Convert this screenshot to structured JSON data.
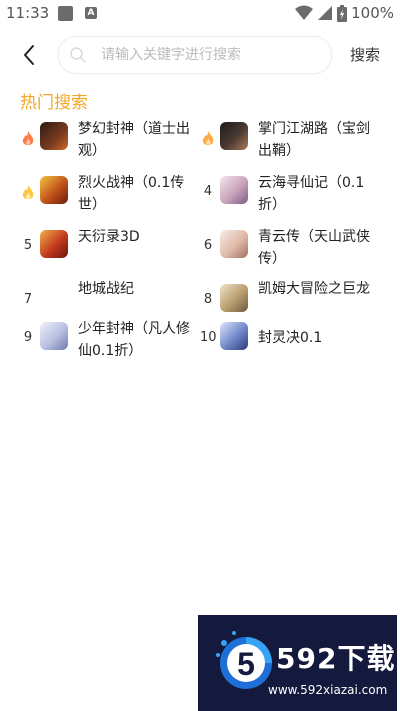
{
  "status_bar": {
    "time": "11:33",
    "battery": "100%",
    "notif_icon_b": "A"
  },
  "search": {
    "placeholder": "请输入关键字进行搜索",
    "value": "",
    "button_label": "搜索"
  },
  "section_title": "热门搜索",
  "hot_items": [
    {
      "rank": "",
      "hot": true,
      "name": "梦幻封神（道士出观）",
      "avatar_color": "#5a2b1a"
    },
    {
      "rank": "",
      "hot": true,
      "name": "掌门江湖路（宝剑出鞘）",
      "avatar_color": "#3b2f28"
    },
    {
      "rank": "",
      "hot": true,
      "name": "烈火战神（0.1传世）",
      "avatar_color": "#b8561b"
    },
    {
      "rank": "4",
      "hot": false,
      "name": "云海寻仙记（0.1折）",
      "avatar_color": "#d9b8c8"
    },
    {
      "rank": "5",
      "hot": false,
      "name": "天衍录3D",
      "avatar_color": "#c33a1e"
    },
    {
      "rank": "6",
      "hot": false,
      "name": "青云传（天山武侠传）",
      "avatar_color": "#e6c9c0"
    },
    {
      "rank": "7",
      "hot": false,
      "name": "地城战纪",
      "avatar_color": ""
    },
    {
      "rank": "8",
      "hot": false,
      "name": "凯姆大冒险之巨龙",
      "avatar_color": "#c9b799"
    },
    {
      "rank": "9",
      "hot": false,
      "name": "少年封神（凡人修仙0.1折）",
      "avatar_color": "#b8bfe0"
    },
    {
      "rank": "10",
      "hot": false,
      "name": "封灵决0.1",
      "avatar_color": "#6f86c8"
    }
  ],
  "watermark": {
    "title": "592下载",
    "url": "www.592xiazai.com",
    "logo_digit": "5"
  },
  "colors": {
    "accent": "#f5a623",
    "fire": "#ff7a45",
    "fire_light": "#ffc53d",
    "watermark_bg": "#141a3e"
  }
}
